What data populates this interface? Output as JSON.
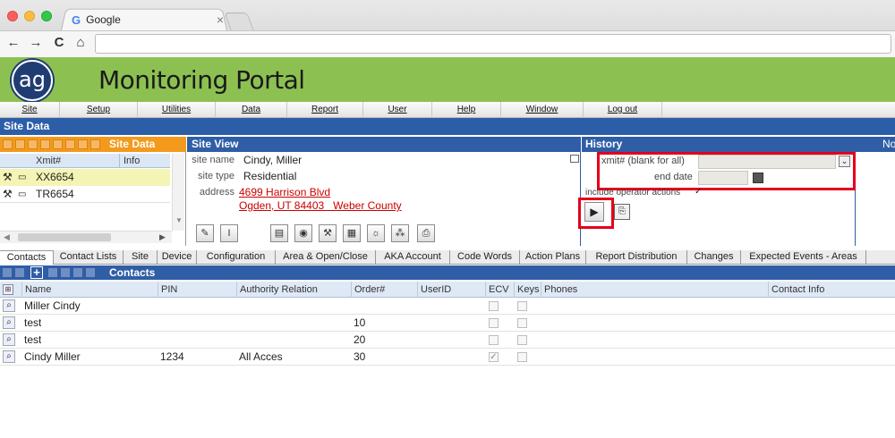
{
  "browser": {
    "tab_title": "Google",
    "tab_icon": "G",
    "tab_close": "×",
    "nav_back": "←",
    "nav_forward": "→",
    "nav_reload": "C",
    "nav_home": "⌂"
  },
  "portal": {
    "logo_text": "ag",
    "title": "Monitoring Portal",
    "accent_color": "#8cc152",
    "header_blue": "#2f5ea6",
    "highlight_red": "#e3001b"
  },
  "menu": [
    "Site",
    "Setup",
    "Utilities",
    "Data",
    "Report",
    "User",
    "Help",
    "Window",
    "Log out"
  ],
  "site_data": {
    "bar_title": "Site Data",
    "panel_title": "Site Data",
    "columns": [
      "Xmit#",
      "Info"
    ],
    "rows": [
      {
        "xmit": "XX6654",
        "selected": true
      },
      {
        "xmit": "TR6654",
        "selected": false
      }
    ]
  },
  "site_view": {
    "title": "Site View",
    "site_name_label": "site name",
    "site_name": "Cindy, Miller",
    "site_type_label": "site type",
    "site_type": "Residential",
    "address_label": "address",
    "address_line1": "4699 Harrison Blvd",
    "address_line2": "Ogden, UT 84403   Weber County"
  },
  "history": {
    "title": "History",
    "xmit_label": "xmit#  (blank for all)",
    "end_date_label": "end date",
    "include_operator_label": "include operator actions",
    "include_operator_checked": true,
    "play_icon": "▶"
  },
  "right_stub": {
    "title": "No"
  },
  "contact_tabs": [
    "Contacts",
    "Contact Lists",
    "Site",
    "Device",
    "Configuration",
    "Area & Open/Close",
    "AKA Account",
    "Code Words",
    "Action Plans",
    "Report Distribution",
    "Changes",
    "Expected Events - Areas"
  ],
  "contacts": {
    "title": "Contacts",
    "columns": [
      "Name",
      "PIN",
      "Authority Relation",
      "Order#",
      "UserID",
      "ECV",
      "Keys",
      "Phones",
      "Contact Info"
    ],
    "rows": [
      {
        "name": "Miller Cindy",
        "pin": "",
        "authority": "",
        "order": "",
        "ecv": false,
        "keys": false
      },
      {
        "name": "test",
        "pin": "",
        "authority": "",
        "order": "10",
        "ecv": false,
        "keys": false
      },
      {
        "name": "test",
        "pin": "",
        "authority": "",
        "order": "20",
        "ecv": false,
        "keys": false
      },
      {
        "name": "Cindy Miller",
        "pin": "1234",
        "authority": "All Acces",
        "order": "30",
        "ecv": true,
        "keys": false
      }
    ]
  }
}
